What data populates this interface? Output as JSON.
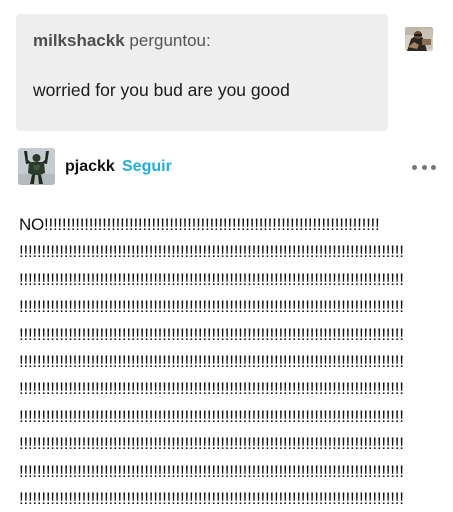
{
  "ask": {
    "author": "milkshackk",
    "verb": "perguntou:",
    "question": "worried for you bud are you good"
  },
  "post": {
    "author": "pjackk",
    "follow_label": "Seguir"
  },
  "answer": {
    "lines": [
      "NO!!!!!!!!!!!!!!!!!!!!!!!!!!!!!!!!!!!!!!!!!!!!!!!!!!!!!!!!!!!!!!!!!!!!!!!!!!!",
      "!!!!!!!!!!!!!!!!!!!!!!!!!!!!!!!!!!!!!!!!!!!!!!!!!!!!!!!!!!!!!!!!!!!!!!!!!!!!!!!!!!!!!!",
      "!!!!!!!!!!!!!!!!!!!!!!!!!!!!!!!!!!!!!!!!!!!!!!!!!!!!!!!!!!!!!!!!!!!!!!!!!!!!!!!!!!!!!!",
      "!!!!!!!!!!!!!!!!!!!!!!!!!!!!!!!!!!!!!!!!!!!!!!!!!!!!!!!!!!!!!!!!!!!!!!!!!!!!!!!!!!!!!!",
      "!!!!!!!!!!!!!!!!!!!!!!!!!!!!!!!!!!!!!!!!!!!!!!!!!!!!!!!!!!!!!!!!!!!!!!!!!!!!!!!!!!!!!!",
      "!!!!!!!!!!!!!!!!!!!!!!!!!!!!!!!!!!!!!!!!!!!!!!!!!!!!!!!!!!!!!!!!!!!!!!!!!!!!!!!!!!!!!!",
      "!!!!!!!!!!!!!!!!!!!!!!!!!!!!!!!!!!!!!!!!!!!!!!!!!!!!!!!!!!!!!!!!!!!!!!!!!!!!!!!!!!!!!!",
      "!!!!!!!!!!!!!!!!!!!!!!!!!!!!!!!!!!!!!!!!!!!!!!!!!!!!!!!!!!!!!!!!!!!!!!!!!!!!!!!!!!!!!!",
      "!!!!!!!!!!!!!!!!!!!!!!!!!!!!!!!!!!!!!!!!!!!!!!!!!!!!!!!!!!!!!!!!!!!!!!!!!!!!!!!!!!!!!!",
      "!!!!!!!!!!!!!!!!!!!!!!!!!!!!!!!!!!!!!!!!!!!!!!!!!!!!!!!!!!!!!!!!!!!!!!!!!!!!!!!!!!!!!!",
      "!!!!!!!!!!!!!!!!!!!!!!!!!!!!!!!!!!!!!!!!!!!!!!!!!!!!!!!!!!!!!!!!!!!!!!!!!!!!!!!!!!!!!!"
    ]
  },
  "icons": {
    "asker_avatar": "avatar-photo-icon",
    "poster_avatar": "avatar-figure-icon",
    "more": "more-options-icon"
  },
  "colors": {
    "ask_background": "#eeeeee",
    "follow_link": "#22aedd",
    "text": "#111111"
  }
}
